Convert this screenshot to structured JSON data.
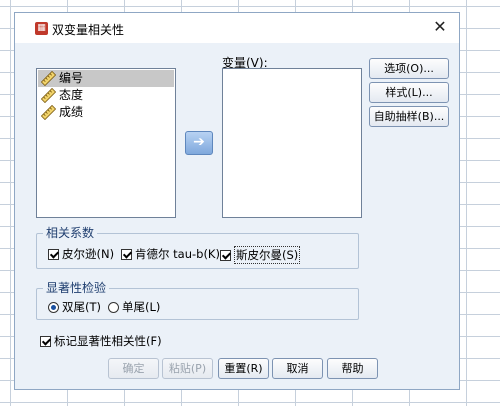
{
  "dialog": {
    "title": "双变量相关性",
    "close_glyph": "✕"
  },
  "source_vars": [
    {
      "label": "编号",
      "selected": true
    },
    {
      "label": "态度",
      "selected": false
    },
    {
      "label": "成绩",
      "selected": false
    }
  ],
  "move_glyph": "➔",
  "target": {
    "label": "变量(V):"
  },
  "side_buttons": {
    "options": "选项(O)...",
    "style": "样式(L)...",
    "bootstrap": "自助抽样(B)..."
  },
  "correlation": {
    "legend": "相关系数",
    "pearson": "皮尔逊(N)",
    "kendall": "肯德尔 tau-b(K)",
    "spearman": "斯皮尔曼(S)"
  },
  "significance": {
    "legend": "显著性检验",
    "two_tailed": "双尾(T)",
    "one_tailed": "单尾(L)"
  },
  "flag": {
    "label": "标记显著性相关性(F)"
  },
  "bottom_buttons": {
    "ok": "确定",
    "paste": "粘贴(P)",
    "reset": "重置(R)",
    "cancel": "取消",
    "help": "帮助"
  }
}
